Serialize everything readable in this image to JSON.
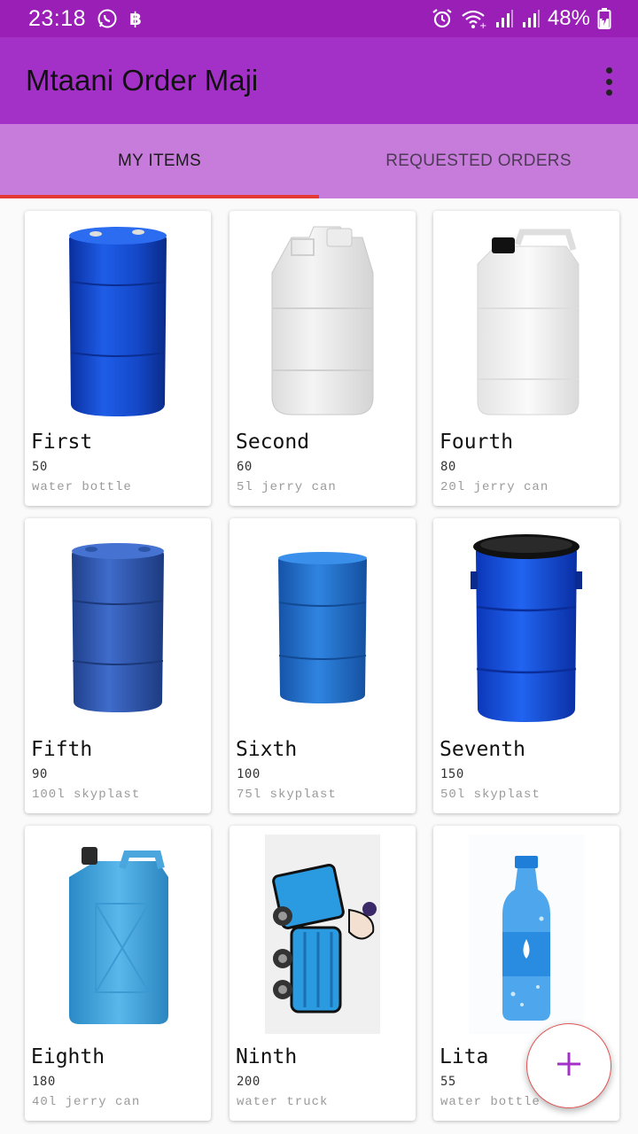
{
  "status_bar": {
    "time": "23:18",
    "battery": "48%",
    "icons": [
      "whatsapp-icon",
      "bitcoin-icon",
      "alarm-icon",
      "wifi-icon",
      "signal-icon",
      "signal-icon-2",
      "battery-icon"
    ]
  },
  "app_bar": {
    "title": "Mtaani Order Maji",
    "menu_icon": "more-vert-icon"
  },
  "tabs": [
    {
      "label": "MY ITEMS",
      "active": true
    },
    {
      "label": "REQUESTED ORDERS",
      "active": false
    }
  ],
  "items": [
    {
      "name": "First",
      "price": "50",
      "description": "water bottle",
      "image": "blue-drum"
    },
    {
      "name": "Second",
      "price": "60",
      "description": "5l jerry can",
      "image": "white-jerry-can"
    },
    {
      "name": "Fourth",
      "price": "80",
      "description": "20l jerry can",
      "image": "white-jerry-can-cap"
    },
    {
      "name": "Fifth",
      "price": "90",
      "description": "100l skyplast",
      "image": "blue-drum"
    },
    {
      "name": "Sixth",
      "price": "100",
      "description": "75l skyplast",
      "image": "blue-drum"
    },
    {
      "name": "Seventh",
      "price": "150",
      "description": "50l skyplast",
      "image": "blue-open-drum"
    },
    {
      "name": "Eighth",
      "price": "180",
      "description": "40l jerry can",
      "image": "light-blue-jerry-can"
    },
    {
      "name": "Ninth",
      "price": "200",
      "description": "water truck",
      "image": "water-truck"
    },
    {
      "name": "Lita",
      "price": "55",
      "description": "water bottle",
      "image": "water-bottle"
    }
  ],
  "fab": {
    "icon": "add-icon",
    "color": "#a431c7"
  },
  "colors": {
    "status_bar": "#9a1fb7",
    "app_bar": "#a431c7",
    "tab_bar": "#c77cdc",
    "tab_indicator": "#e53935"
  }
}
